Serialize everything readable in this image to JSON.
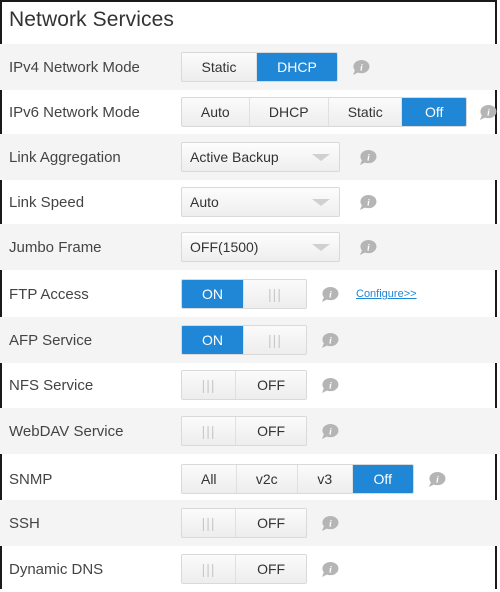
{
  "title": "Network Services",
  "rows": {
    "ipv4": {
      "label": "IPv4 Network Mode",
      "options": [
        "Static",
        "DHCP"
      ],
      "selected": "DHCP"
    },
    "ipv6": {
      "label": "IPv6 Network Mode",
      "options": [
        "Auto",
        "DHCP",
        "Static",
        "Off"
      ],
      "selected": "Off"
    },
    "link_aggregation": {
      "label": "Link Aggregation",
      "value": "Active Backup"
    },
    "link_speed": {
      "label": "Link Speed",
      "value": "Auto"
    },
    "jumbo_frame": {
      "label": "Jumbo Frame",
      "value": "OFF(1500)"
    },
    "ftp": {
      "label": "FTP Access",
      "state": "ON",
      "on_label": "ON",
      "grip": "|||",
      "link": "Configure>>"
    },
    "afp": {
      "label": "AFP Service",
      "state": "ON",
      "on_label": "ON",
      "grip": "|||"
    },
    "nfs": {
      "label": "NFS Service",
      "state": "OFF",
      "off_label": "OFF",
      "grip": "|||"
    },
    "webdav": {
      "label": "WebDAV Service",
      "state": "OFF",
      "off_label": "OFF",
      "grip": "|||"
    },
    "snmp": {
      "label": "SNMP",
      "options": [
        "All",
        "v2c",
        "v3",
        "Off"
      ],
      "selected": "Off"
    },
    "ssh": {
      "label": "SSH",
      "state": "OFF",
      "off_label": "OFF",
      "grip": "|||"
    },
    "ddns": {
      "label": "Dynamic DNS",
      "state": "OFF",
      "off_label": "OFF",
      "grip": "|||"
    }
  },
  "icons": {
    "info": "info-speech-bubble-icon",
    "dropdown": "chevron-down-icon"
  },
  "colors": {
    "accent": "#1f87d6",
    "info_icon": "#b5b5b5",
    "alt_row": "#f4f4f4"
  }
}
